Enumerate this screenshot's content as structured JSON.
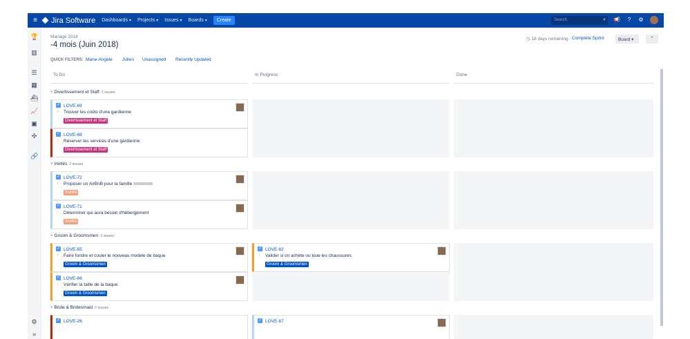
{
  "topbar": {
    "app_name": "Jira Software",
    "nav": [
      "Dashboards",
      "Projects",
      "Issues",
      "Boards"
    ],
    "create": "Create",
    "search_placeholder": "Search"
  },
  "board": {
    "breadcrumb": "Mariage 2018",
    "title": "-4 mois (Juin 2018)",
    "quick_filters_label": "QUICK FILTERS:",
    "quick_filters": [
      "Marie-Angèle",
      "Julien",
      "Unassigned",
      "Recently Updated"
    ],
    "remaining": "18 days remaining",
    "complete_sprint": "Complete Sprint",
    "board_button": "Board",
    "columns": [
      "To Do",
      "In Progress",
      "Done"
    ]
  },
  "swimlanes": [
    {
      "name": "Divertissement et Staff",
      "count": "2 issues"
    },
    {
      "name": "Invités",
      "count": "2 issues"
    },
    {
      "name": "Groom & Groomsmen",
      "count": "3 issues"
    },
    {
      "name": "Bride & Bridesmaid",
      "count": "2 issues"
    }
  ],
  "cards": [
    {
      "key": "LOVE-69",
      "summary": "Trouver les coûts d'une gardienne",
      "label": "Divertissement et Staff"
    },
    {
      "key": "LOVE-68",
      "summary": "Réserver les services d'une gardienne",
      "label": "Divertissement et Staff"
    },
    {
      "key": "LOVE-72",
      "summary": "Proposer un AirBnB pour la famille",
      "label": "Invités"
    },
    {
      "key": "LOVE-71",
      "summary": "Déterminer qui aura besoin d'hébergement",
      "label": "Invités"
    },
    {
      "key": "LOVE-65",
      "summary": "Faire fondre et couler le nouveau modèle de baque",
      "label": "Groom & Groomsmen"
    },
    {
      "key": "LOVE-62",
      "summary": "Valider si on achète ou loue les chaussures",
      "label": "Groom & Groomsmen"
    },
    {
      "key": "LOVE-66",
      "summary": "Vérifier la taille de la baque",
      "label": "Groom & Groomsmen"
    },
    {
      "key": "LOVE-26",
      "summary": "",
      "label": ""
    },
    {
      "key": "LOVE-87",
      "summary": "",
      "label": ""
    }
  ],
  "colors": {
    "topbar": "#0747a6",
    "label_pink": "#c9317f",
    "label_orange": "#f79f7a",
    "label_blue": "#0052cc",
    "border_red": "#bf2600",
    "border_orange": "#ff991f",
    "border_lightblue": "#b3d4ff"
  },
  "icons": [
    "menu-icon",
    "search-icon",
    "notifications-icon",
    "help-icon",
    "settings-icon",
    "user-avatar"
  ]
}
